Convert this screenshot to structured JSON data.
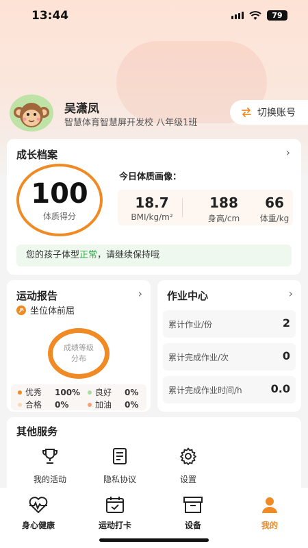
{
  "status_bar": {
    "time": "13:44",
    "battery": "79"
  },
  "profile": {
    "name": "吴潇凤",
    "school": "智慧体育智慧屏开发校 八年级1班",
    "switch_label": "切换账号"
  },
  "growth": {
    "title": "成长档案",
    "score": "100",
    "score_label": "体质得分",
    "today_label": "今日体质画像：",
    "metrics": [
      {
        "value": "18.7",
        "unit": "BMI/kg/m²"
      },
      {
        "value": "188",
        "unit": "身高/cm"
      },
      {
        "value": "66",
        "unit": "体重/kg"
      }
    ],
    "notice_prefix": "您的孩子体型",
    "notice_status": "正常",
    "notice_suffix": "，请继续保持哦"
  },
  "sport_report": {
    "title": "运动报告",
    "item": "坐位体前屈",
    "ring_text_line1": "成绩等级",
    "ring_text_line2": "分布",
    "legend": [
      {
        "label": "优秀",
        "pct": "100%",
        "color": "#f08a24"
      },
      {
        "label": "良好",
        "pct": "0%",
        "color": "#a8dca0"
      },
      {
        "label": "合格",
        "pct": "0%",
        "color": "#f7d9b8"
      },
      {
        "label": "加油",
        "pct": "0%",
        "color": "#f4a070"
      }
    ]
  },
  "homework": {
    "title": "作业中心",
    "rows": [
      {
        "label": "累计作业/份",
        "value": "2"
      },
      {
        "label": "累计完成作业/次",
        "value": "0"
      },
      {
        "label": "累计完成作业时间/h",
        "value": "0.0"
      }
    ]
  },
  "services": {
    "title": "其他服务",
    "items": [
      {
        "label": "我的活动",
        "icon": "trophy-icon"
      },
      {
        "label": "隐私协议",
        "icon": "document-icon"
      },
      {
        "label": "设置",
        "icon": "gear-icon"
      }
    ]
  },
  "tabbar": {
    "tabs": [
      {
        "label": "身心健康",
        "icon": "heart-pulse-icon"
      },
      {
        "label": "运动打卡",
        "icon": "calendar-check-icon"
      },
      {
        "label": "设备",
        "icon": "box-icon"
      },
      {
        "label": "我的",
        "icon": "person-icon",
        "active": true
      }
    ]
  },
  "colors": {
    "accent": "#f08a24",
    "good": "#3aa84a"
  }
}
